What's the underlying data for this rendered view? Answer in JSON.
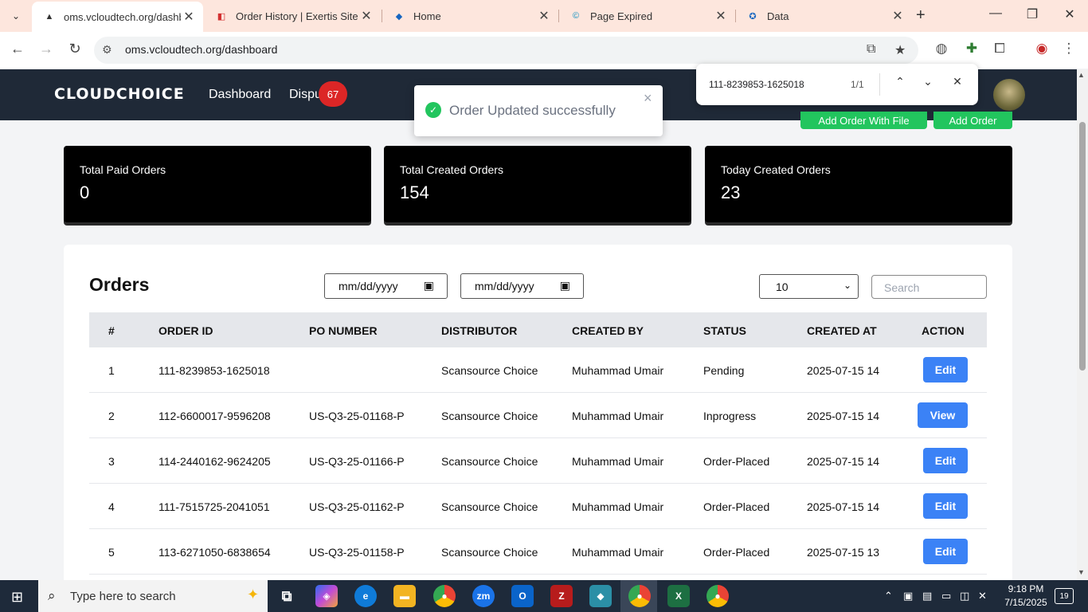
{
  "browser": {
    "tabs": [
      {
        "title": "oms.vcloudtech.org/dashboard",
        "icon": "triangle-icon"
      },
      {
        "title": "Order History | Exertis Site",
        "icon": "exertis-icon"
      },
      {
        "title": "Home",
        "icon": "home-icon"
      },
      {
        "title": "Page Expired",
        "icon": "c-icon"
      },
      {
        "title": "Data",
        "icon": "data-icon"
      }
    ],
    "url": "oms.vcloudtech.org/dashboard"
  },
  "find": {
    "query": "111-8239853-1625018",
    "count": "1/1"
  },
  "toast": {
    "message": "Order Updated successfully"
  },
  "header": {
    "logo": "CLOUDCHOICE",
    "nav": [
      "Dashboard",
      "Dispu"
    ],
    "badge": "67",
    "buttons": [
      "Add Order With File",
      "Add Order"
    ]
  },
  "cards": [
    {
      "label": "Total Paid Orders",
      "value": "0"
    },
    {
      "label": "Total Created Orders",
      "value": "154"
    },
    {
      "label": "Today Created Orders",
      "value": "23"
    }
  ],
  "orders": {
    "title": "Orders",
    "date_placeholder": "mm/dd/yyyy",
    "page_size": "10",
    "search_placeholder": "Search",
    "columns": [
      "#",
      "ORDER ID",
      "PO NUMBER",
      "DISTRIBUTOR",
      "CREATED BY",
      "STATUS",
      "CREATED AT",
      "ACTION"
    ],
    "rows": [
      {
        "n": "1",
        "order_id": "111-8239853-1625018",
        "po": "",
        "distributor": "Scansource Choice",
        "created_by": "Muhammad Umair",
        "status": "Pending",
        "created_at": "2025-07-15 14",
        "action": "Edit"
      },
      {
        "n": "2",
        "order_id": "112-6600017-9596208",
        "po": "US-Q3-25-01168-P",
        "distributor": "Scansource Choice",
        "created_by": "Muhammad Umair",
        "status": "Inprogress",
        "created_at": "2025-07-15 14",
        "action": "View"
      },
      {
        "n": "3",
        "order_id": "114-2440162-9624205",
        "po": "US-Q3-25-01166-P",
        "distributor": "Scansource Choice",
        "created_by": "Muhammad Umair",
        "status": "Order-Placed",
        "created_at": "2025-07-15 14",
        "action": "Edit"
      },
      {
        "n": "4",
        "order_id": "111-7515725-2041051",
        "po": "US-Q3-25-01162-P",
        "distributor": "Scansource Choice",
        "created_by": "Muhammad Umair",
        "status": "Order-Placed",
        "created_at": "2025-07-15 14",
        "action": "Edit"
      },
      {
        "n": "5",
        "order_id": "113-6271050-6838654",
        "po": "US-Q3-25-01158-P",
        "distributor": "Scansource Choice",
        "created_by": "Muhammad Umair",
        "status": "Order-Placed",
        "created_at": "2025-07-15 13",
        "action": "Edit"
      }
    ]
  },
  "taskbar": {
    "search_placeholder": "Type here to search",
    "time": "9:18 PM",
    "date": "7/15/2025",
    "notifications": "19"
  },
  "colors": {
    "header_bg": "#1f2937",
    "accent_blue": "#3b82f6",
    "success_green": "#22c55e",
    "badge_red": "#dc2626"
  }
}
